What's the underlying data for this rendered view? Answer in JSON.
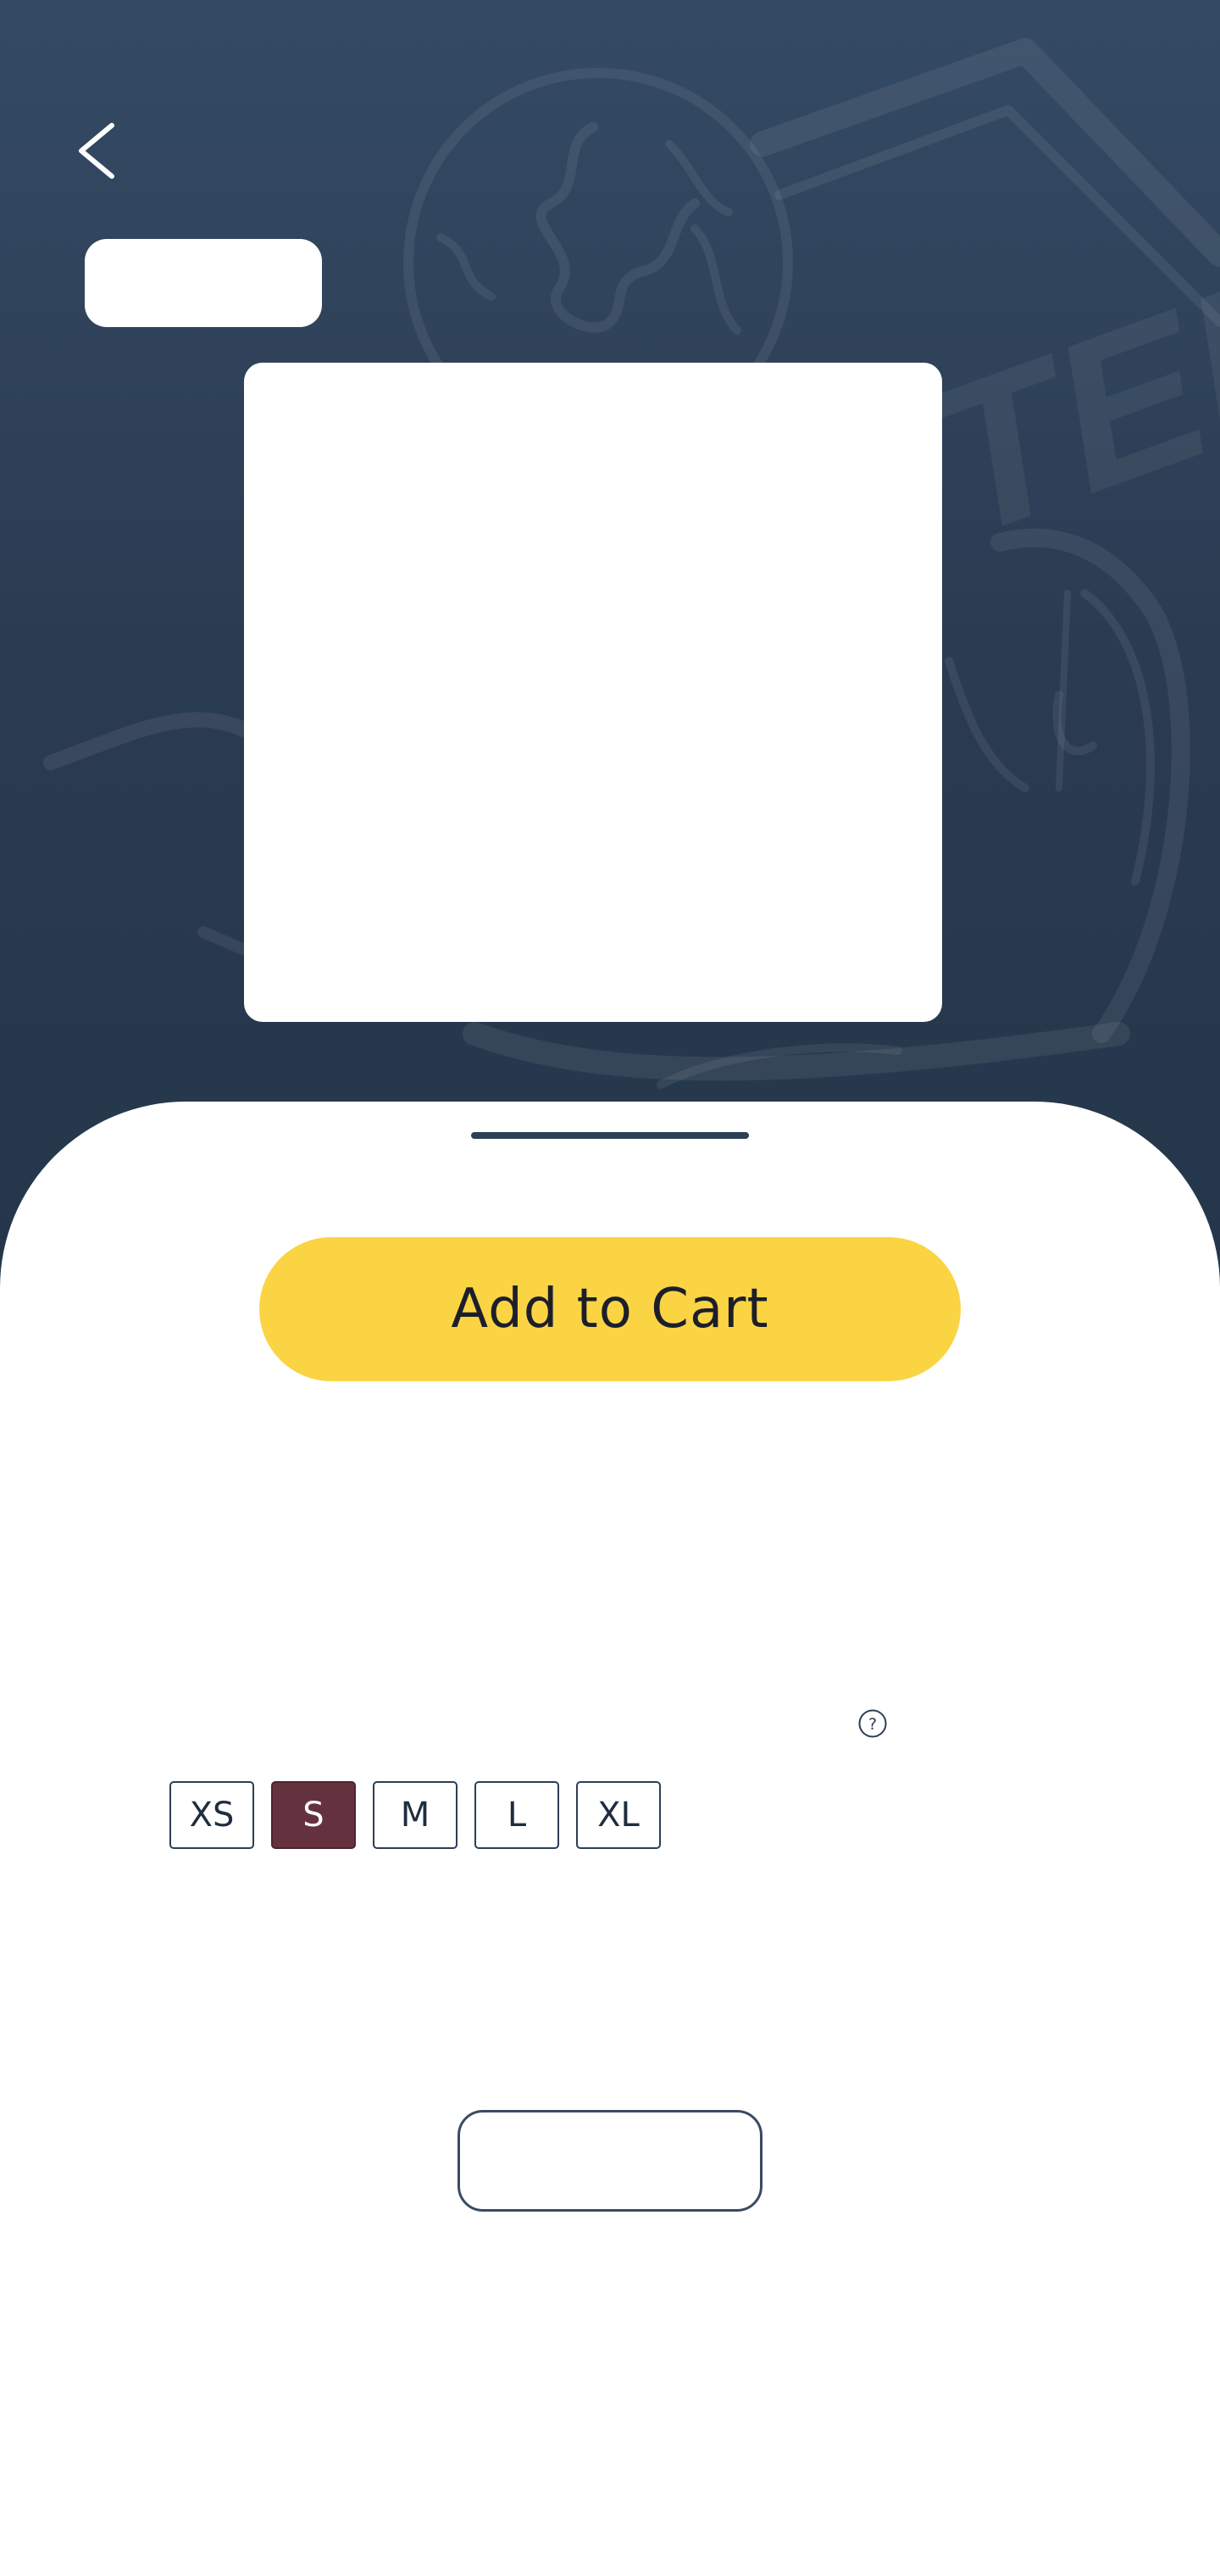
{
  "header": {
    "back_icon": "chevron-left-icon"
  },
  "sizes": {
    "options": [
      "XS",
      "S",
      "M",
      "L",
      "XL"
    ],
    "selected": "S",
    "help_icon": "question-circle-icon"
  },
  "cart": {
    "add_label": "Add to Cart"
  },
  "colors": {
    "hero_background": "#2e4058",
    "selected_size": "#64323f",
    "add_button": "#fad443"
  }
}
